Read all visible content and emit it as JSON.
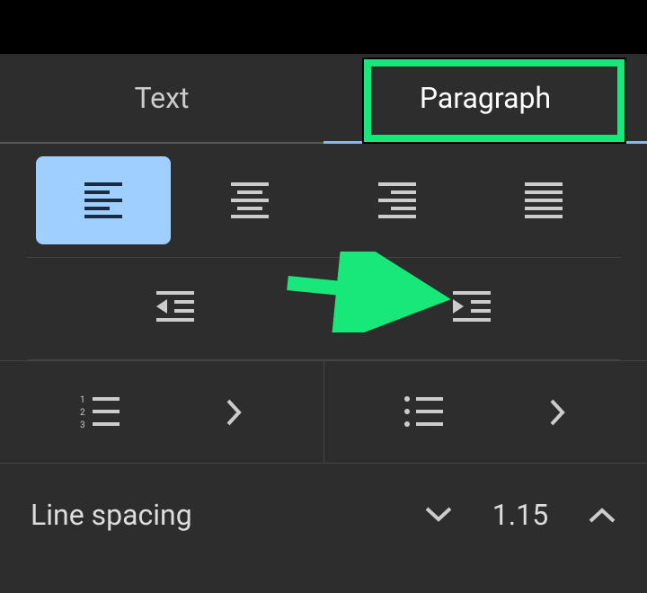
{
  "tabs": {
    "text": "Text",
    "paragraph": "Paragraph"
  },
  "line_spacing": {
    "label": "Line spacing",
    "value": "1.15"
  },
  "icons": {
    "align_left": "align-left-icon",
    "align_center": "align-center-icon",
    "align_right": "align-right-icon",
    "align_justify": "align-justify-icon",
    "decrease_indent": "decrease-indent-icon",
    "increase_indent": "increase-indent-icon",
    "numbered_list": "numbered-list-icon",
    "bulleted_list": "bulleted-list-icon",
    "chevron_right": "chevron-right-icon",
    "chevron_down": "chevron-down-icon",
    "chevron_up": "chevron-up-icon"
  }
}
